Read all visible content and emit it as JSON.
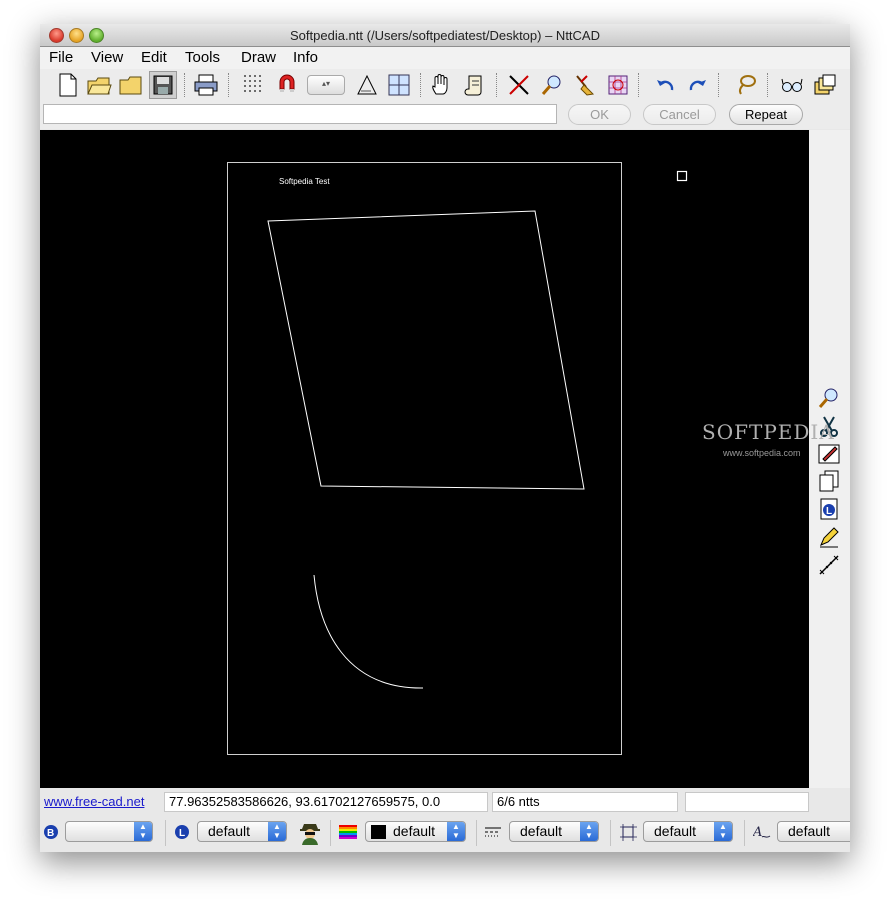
{
  "window": {
    "title": "Softpedia.ntt (/Users/softpediatest/Desktop) – NttCAD"
  },
  "menu": [
    "File",
    "View",
    "Edit",
    "Tools",
    "Draw",
    "Info"
  ],
  "toolbar_icons": [
    "new-file-icon",
    "open-folder-icon",
    "folder-icon",
    "save-icon",
    "print-icon",
    "grid-icon",
    "magnet-snap-icon",
    "snap-spinner-icon",
    "set-square-icon",
    "crosshair-icon",
    "pan-hand-icon",
    "scroll-icon",
    "trim-icon",
    "magnify-icon",
    "broom-icon",
    "selection-grid-icon",
    "undo-icon",
    "redo-icon",
    "lasso-icon",
    "glasses-icon",
    "layers-icon"
  ],
  "command": {
    "input_value": "",
    "ok_label": "OK",
    "cancel_label": "Cancel",
    "repeat_label": "Repeat"
  },
  "drawing": {
    "text_label": "Softpedia Test"
  },
  "right_tools": [
    "zoom-icon",
    "scissors-icon",
    "edit-pen-icon",
    "copy-pages-icon",
    "layer-l-icon",
    "pencil-icon",
    "measure-icon"
  ],
  "watermark": {
    "brand": "SOFTPEDIA",
    "url": "www.softpedia.com"
  },
  "status": {
    "link": "www.free-cad.net",
    "coordinates": "77.96352583586626, 93.61702127659575, 0.0",
    "count": "6/6 ntts",
    "extra": ""
  },
  "properties": {
    "block_value": "",
    "layer_value": "default",
    "color_value": "default",
    "linetype_value": "default",
    "dimstyle_value": "default",
    "textstyle_value": "default"
  },
  "colors": {
    "canvas": "#000000",
    "drawing_stroke": "#ffffff",
    "selected_color_swatch": "#000000"
  }
}
